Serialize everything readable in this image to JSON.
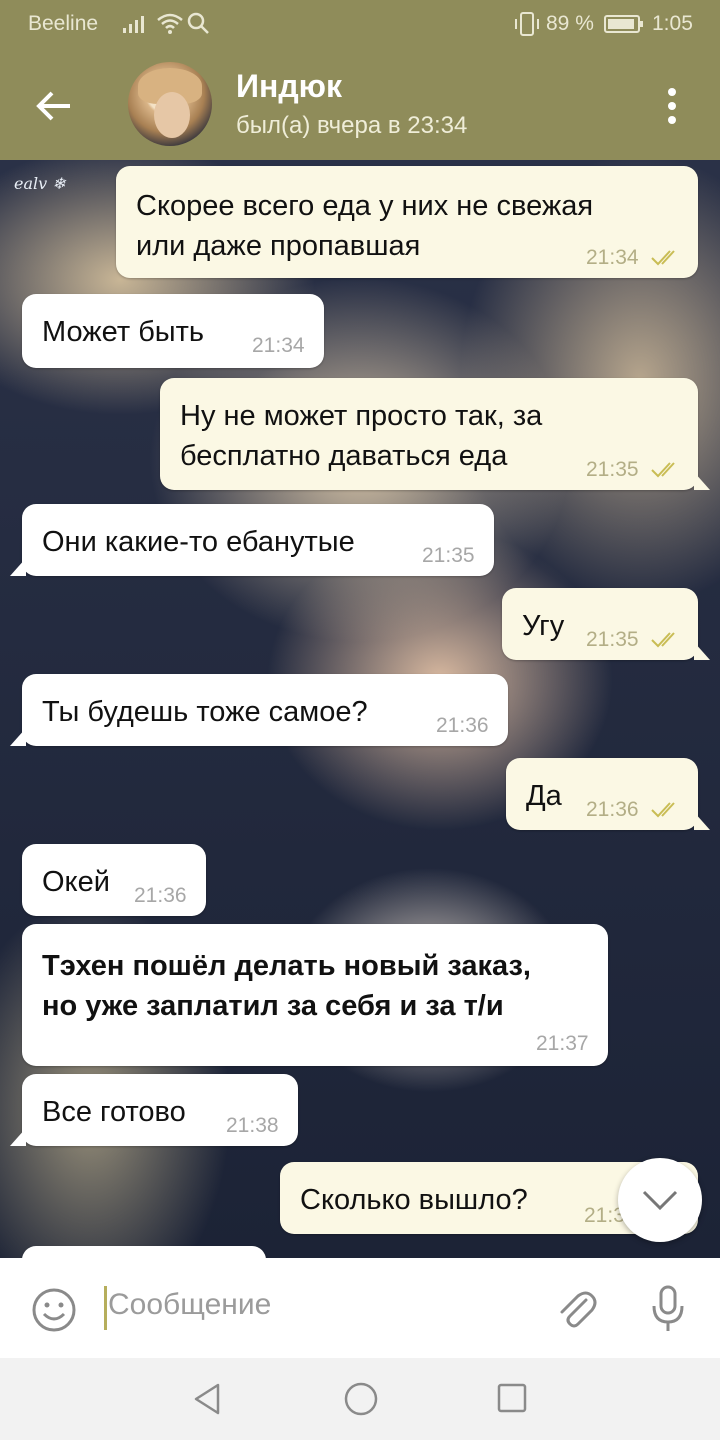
{
  "status_bar": {
    "carrier": "Beeline",
    "battery_percent": "89 %",
    "time": "1:05"
  },
  "header": {
    "contact_name": "Индюк",
    "last_seen": "был(а) вчера в 23:34",
    "back_icon": "arrow-left-icon",
    "menu_icon": "more-vertical-icon"
  },
  "background": {
    "watermark": "ealv ❄"
  },
  "messages": [
    {
      "direction": "out",
      "lines": [
        "Скорее всего еда у них не свежая",
        "или даже пропавшая"
      ],
      "time": "21:34",
      "read": true
    },
    {
      "direction": "in",
      "lines": [
        "Может быть"
      ],
      "time": "21:34"
    },
    {
      "direction": "out",
      "lines": [
        "Ну не может просто так, за",
        "бесплатно даваться еда"
      ],
      "time": "21:35",
      "read": true
    },
    {
      "direction": "in",
      "lines": [
        "Они какие-то ебанутые"
      ],
      "time": "21:35"
    },
    {
      "direction": "out",
      "lines": [
        "Угу"
      ],
      "time": "21:35",
      "read": true
    },
    {
      "direction": "in",
      "lines": [
        "Ты будешь тоже самое?"
      ],
      "time": "21:36"
    },
    {
      "direction": "out",
      "lines": [
        "Да"
      ],
      "time": "21:36",
      "read": true
    },
    {
      "direction": "in",
      "lines": [
        "Окей"
      ],
      "time": "21:36"
    },
    {
      "direction": "in",
      "bold": true,
      "lines": [
        "Тэхен пошёл делать новый заказ,",
        "но уже заплатил за себя и за т/и"
      ],
      "time": "21:37"
    },
    {
      "direction": "in",
      "lines": [
        "Все готово"
      ],
      "time": "21:38"
    },
    {
      "direction": "out",
      "lines": [
        "Сколько вышло?"
      ],
      "time": "21:3"
    }
  ],
  "composer": {
    "placeholder": "Сообщение",
    "emoji_icon": "smile-icon",
    "attach_icon": "paperclip-icon",
    "mic_icon": "microphone-icon"
  },
  "colors": {
    "header": "#8f8c5a",
    "outgoing_bubble": "#fbf8e4",
    "incoming_bubble": "#ffffff",
    "read_ticks": "#c9bd55"
  }
}
